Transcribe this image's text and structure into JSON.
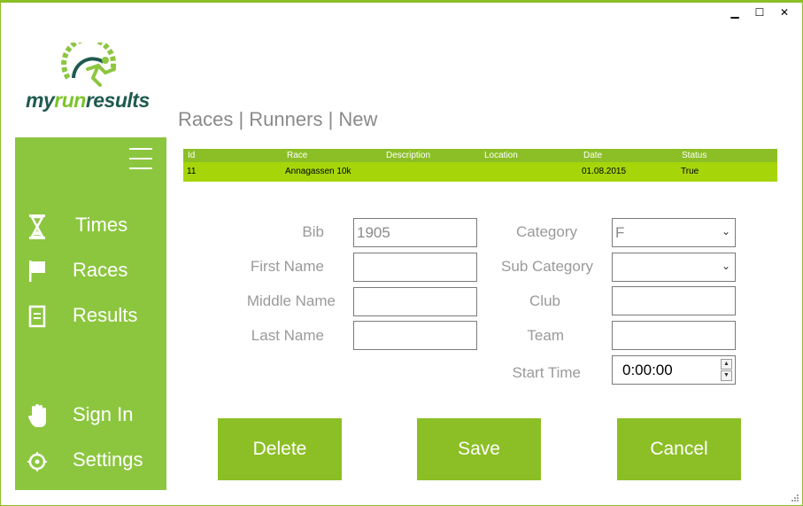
{
  "window": {
    "minimize": "▁",
    "maximize": "☐",
    "close": "✕"
  },
  "logo": {
    "text_dark_1": "my",
    "text_green": "run",
    "text_dark_2": "results"
  },
  "sidebar": {
    "items": [
      {
        "label": "Times",
        "icon": "hourglass-icon"
      },
      {
        "label": "Races",
        "icon": "flag-icon"
      },
      {
        "label": "Results",
        "icon": "document-icon"
      },
      {
        "label": "Sign In",
        "icon": "hand-icon"
      },
      {
        "label": "Settings",
        "icon": "gear-icon"
      }
    ]
  },
  "breadcrumb": "Races | Runners | New",
  "race_grid": {
    "columns": [
      "Id",
      "Race",
      "Description",
      "Location",
      "Date",
      "Status"
    ],
    "rows": [
      {
        "id": "11",
        "race": "Annagassen 10k",
        "description": "",
        "location": "",
        "date": "01.08.2015",
        "status": "True"
      }
    ]
  },
  "form": {
    "bib": {
      "label": "Bib",
      "value": "1905"
    },
    "first_name": {
      "label": "First Name",
      "value": ""
    },
    "middle_name": {
      "label": "Middle Name",
      "value": ""
    },
    "last_name": {
      "label": "Last Name",
      "value": ""
    },
    "category": {
      "label": "Category",
      "value": "F"
    },
    "sub_category": {
      "label": "Sub Category",
      "value": ""
    },
    "club": {
      "label": "Club",
      "value": ""
    },
    "team": {
      "label": "Team",
      "value": ""
    },
    "start_time": {
      "label": "Start Time",
      "value": "0:00:00"
    }
  },
  "buttons": {
    "delete": "Delete",
    "save": "Save",
    "cancel": "Cancel"
  },
  "colors": {
    "accent": "#8cbf26",
    "sidebar": "#8cc63f",
    "grid_row": "#a6d60a",
    "logo_dark": "#1f5a50"
  }
}
